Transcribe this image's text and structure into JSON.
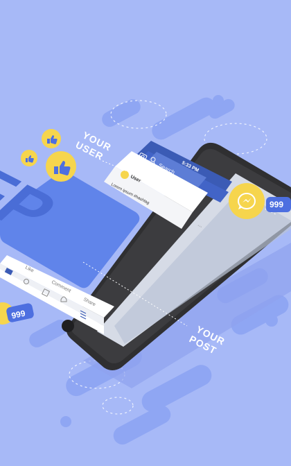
{
  "labels": {
    "your_user_1": "YOUR",
    "your_user_2": "USER",
    "your_post_1": "YOUR",
    "your_post_2": "POST",
    "fp": "FP"
  },
  "phone": {
    "status_time": "5:33 PM",
    "search_placeholder": "Search",
    "post_user": "User",
    "post_text": "Lorem ipsum #hashtag",
    "actions": [
      "Like",
      "Comment",
      "Share"
    ]
  },
  "badges": {
    "left_count": "999",
    "right_count": "999"
  },
  "icons": {
    "like": "thumbs-up-icon",
    "messenger": "messenger-icon",
    "camera": "camera-icon",
    "search": "search-icon"
  },
  "colors": {
    "background": "#a7b9f7",
    "accent_blue": "#4d6fe0",
    "facebook_blue": "#3b5bb5",
    "yellow": "#f6d54d",
    "phone_body": "#2f2f31"
  }
}
